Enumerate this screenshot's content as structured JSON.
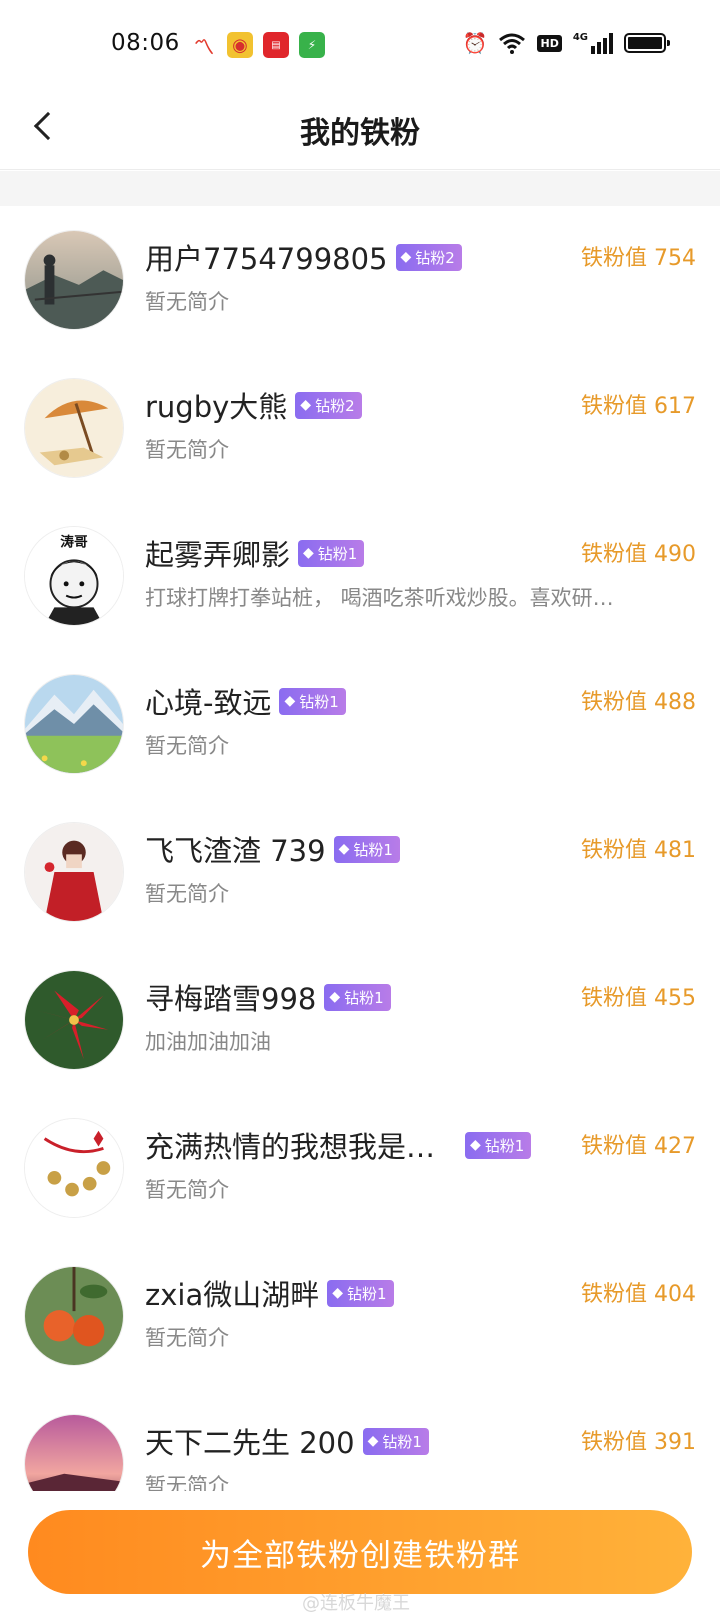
{
  "status_bar": {
    "time": "08:06",
    "notification_icons": [
      "stock-app-icon",
      "weibo-icon",
      "toutiao-icon",
      "security-app-icon"
    ],
    "system_icons": [
      "alarm-icon",
      "wifi-icon",
      "hd-icon",
      "signal-4g-icon",
      "battery-icon"
    ],
    "hd_label": "HD",
    "network_label": "4G"
  },
  "header": {
    "title": "我的铁粉"
  },
  "fans": [
    {
      "name": "用户7754799805",
      "badge": "钻粉2",
      "bio": "暂无简介",
      "score": "铁粉值 754",
      "avatar": "mountain-person-avatar"
    },
    {
      "name": "rugby大熊",
      "badge": "钻粉2",
      "bio": "暂无简介",
      "score": "铁粉值 617",
      "avatar": "beach-umbrella-avatar"
    },
    {
      "name": "起雾弄卿影",
      "badge": "钻粉1",
      "bio": "打球打牌打拳站桩， 喝酒吃茶听戏炒股。喜欢研…",
      "score": "铁粉值 490",
      "avatar": "cartoon-face-avatar",
      "avatar_text": "涛哥"
    },
    {
      "name": "心境-致远",
      "badge": "钻粉1",
      "bio": "暂无简介",
      "score": "铁粉值 488",
      "avatar": "mountain-meadow-avatar"
    },
    {
      "name": "飞飞渣渣 739",
      "badge": "钻粉1",
      "bio": "暂无简介",
      "score": "铁粉值 481",
      "avatar": "woman-red-dress-avatar"
    },
    {
      "name": "寻梅踏雪998",
      "badge": "钻粉1",
      "bio": "加油加油加油",
      "score": "铁粉值 455",
      "avatar": "red-flower-avatar"
    },
    {
      "name": "充满热情的我想我是…",
      "badge": "钻粉1",
      "bio": "暂无简介",
      "score": "铁粉值 427",
      "avatar": "chinese-knot-avatar"
    },
    {
      "name": "zxia微山湖畔",
      "badge": "钻粉1",
      "bio": "暂无简介",
      "score": "铁粉值 404",
      "avatar": "persimmon-avatar"
    },
    {
      "name": "天下二先生 200",
      "badge": "钻粉1",
      "bio": "暂无简介",
      "score": "铁粉值 391",
      "avatar": "sunset-avatar"
    }
  ],
  "cta": {
    "label": "为全部铁粉创建铁粉群"
  },
  "watermark": "@连板牛魔王",
  "colors": {
    "score": "#e79a2a",
    "badge_start": "#8a6cf0",
    "badge_end": "#b87ce8",
    "cta_start": "#ff8a1f",
    "cta_end": "#ffb23a"
  }
}
